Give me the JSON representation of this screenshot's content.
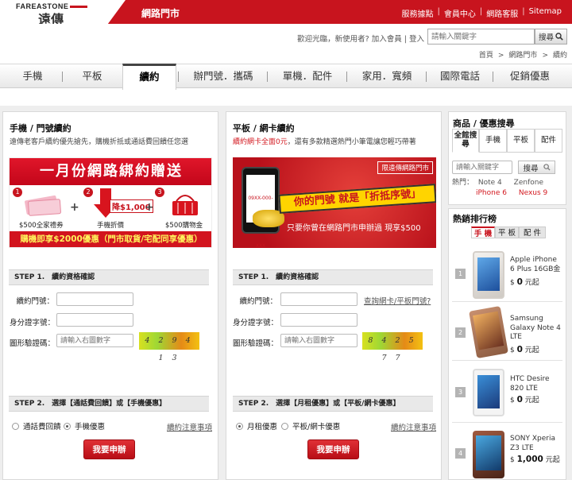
{
  "header": {
    "logo_en": "FAREASTONE",
    "logo_cn": "遠傳",
    "site_title": "網路門市",
    "top_links": [
      "服務據點",
      "會員中心",
      "網路客服",
      "Sitemap"
    ]
  },
  "user_bar": {
    "welcome": "歡迎光臨，新使用者?",
    "join": "加入會員",
    "login": "登入",
    "search_placeholder": "請輸入關鍵字",
    "search_button": "搜尋"
  },
  "breadcrumb": [
    "首頁",
    "網路門市",
    "續約"
  ],
  "nav": {
    "tabs": [
      "手機",
      "平板",
      "續約",
      "辦門號．攜碼",
      "單機．配件",
      "家用．寬頻",
      "國際電話",
      "促銷優惠"
    ],
    "active": "續約"
  },
  "panel_left": {
    "title": "手機 / 門號續約",
    "desc": "遠傳老客戶續約優先搶先，購機折抵或通話費回饋任您選",
    "banner": {
      "headline": "一月份網路綁約贈送",
      "items": [
        {
          "num": "1",
          "caption": "$500全家禮券"
        },
        {
          "num": "2",
          "caption": "手機折價",
          "tag": "降$1,000"
        },
        {
          "num": "3",
          "caption": "$500購物金"
        }
      ],
      "footer": "購機即享$2000優惠（門市取貨/宅配同享優惠）"
    },
    "step1": "STEP 1.　續約資格確認",
    "label_number": "續約門號：",
    "label_id": "身分證字號：",
    "label_captcha": "圖形驗證碼：",
    "captcha_placeholder": "請輸入右圖數字",
    "captcha_text": "4 2 9 4 1 3",
    "step2": "STEP 2.　選擇【通話費回饋】或【手機優惠】",
    "radio1": "通話費回饋",
    "radio2": "手機優惠",
    "notice": "續約注意事項",
    "apply": "我要申辦"
  },
  "panel_mid": {
    "title": "平板 / 網卡續約",
    "desc_red": "續約網卡全面0元",
    "desc_rest": "，還有多款精選熱門小筆電讓您輕巧帶著",
    "banner": {
      "ribbon": "限遠傳網路門市",
      "screen": "09XX-000-XXX",
      "slogan": "你的門號 就是「折抵序號」",
      "footer": "只要你曾在網路門市申辦過 現享$500"
    },
    "step1": "STEP 1.　續約資格確認",
    "label_number": "續約門號：",
    "query_link": "查詢網卡/平板門號?",
    "label_id": "身分證字號：",
    "label_captcha": "圖形驗證碼：",
    "captcha_placeholder": "請輸入右圖數字",
    "captcha_text": "8 4 2 5 7 7",
    "step2": "STEP 2.　選擇【月租優惠】或【平板/網卡優惠】",
    "radio1": "月租優惠",
    "radio2": "平板/網卡優惠",
    "notice": "續約注意事項",
    "apply": "我要申辦"
  },
  "sidebar": {
    "search_title": "商品 / 優惠搜尋",
    "tabs": [
      "全館搜尋",
      "手機",
      "平板",
      "配件"
    ],
    "search_placeholder": "請輸入關鍵字",
    "search_button": "搜尋",
    "hot_label": "熱門：",
    "hot_1": "Note 4",
    "hot_2": "Zenfone",
    "hot_3": "iPhone 6",
    "hot_4": "Nexus 9",
    "ranking_title": "熱銷排行榜",
    "ranking_tabs": [
      "手 機",
      "平 板",
      "配 件"
    ],
    "ranking": [
      {
        "rank": "1",
        "name": "Apple iPhone 6 Plus 16GB金",
        "price": "0",
        "suffix": "元起",
        "color": "#d9d6d2"
      },
      {
        "rank": "2",
        "name": "Samsung Galaxy Note 4 LTE",
        "price": "0",
        "suffix": "元起",
        "color": "#b07a5a"
      },
      {
        "rank": "3",
        "name": "HTC Desire 820 LTE",
        "price": "0",
        "suffix": "元起",
        "color": "#2e4b8c"
      },
      {
        "rank": "4",
        "name": "SONY Xperia Z3 LTE",
        "price": "1,000",
        "suffix": "元起",
        "color": "#7a3a2a"
      }
    ]
  },
  "colors": {
    "brand_red": "#c8141e",
    "gray_bg": "#eeeeee"
  }
}
